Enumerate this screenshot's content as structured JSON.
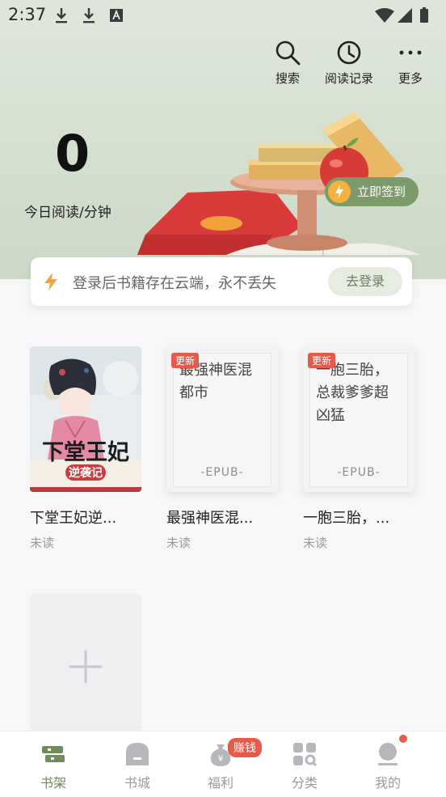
{
  "status_bar": {
    "time": "2:37"
  },
  "top_actions": [
    {
      "label": "搜索",
      "icon": "search-icon"
    },
    {
      "label": "阅读记录",
      "icon": "clock-icon"
    },
    {
      "label": "更多",
      "icon": "more-icon"
    }
  ],
  "reading": {
    "minutes": "0",
    "label": "今日阅读/分钟"
  },
  "signin": {
    "label": "立即签到"
  },
  "login_banner": {
    "text": "登录后书籍存在云端，永不丢失",
    "button": "去登录"
  },
  "books": [
    {
      "title": "下堂王妃逆...",
      "status": "未读",
      "cover_title": "下堂王妃",
      "cover_sub": "逆袭记",
      "badge": ""
    },
    {
      "title": "最强神医混...",
      "status": "未读",
      "cover_title": "最强神医混都市",
      "cover_tag": "-EPUB-",
      "badge": "更新"
    },
    {
      "title": "一胞三胎，...",
      "status": "未读",
      "cover_title": "一胞三胎，总裁爹爹超凶猛",
      "cover_tag": "-EPUB-",
      "badge": "更新"
    }
  ],
  "bottom_nav": [
    {
      "label": "书架",
      "active": true
    },
    {
      "label": "书城",
      "active": false
    },
    {
      "label": "福利",
      "active": false
    },
    {
      "label": "分类",
      "active": false
    },
    {
      "label": "我的",
      "active": false
    }
  ],
  "earn_badge": "赚钱",
  "colors": {
    "accent": "#6f8d5c",
    "header_bg": "#d4dfcf",
    "badge_red": "#e55a4b"
  }
}
